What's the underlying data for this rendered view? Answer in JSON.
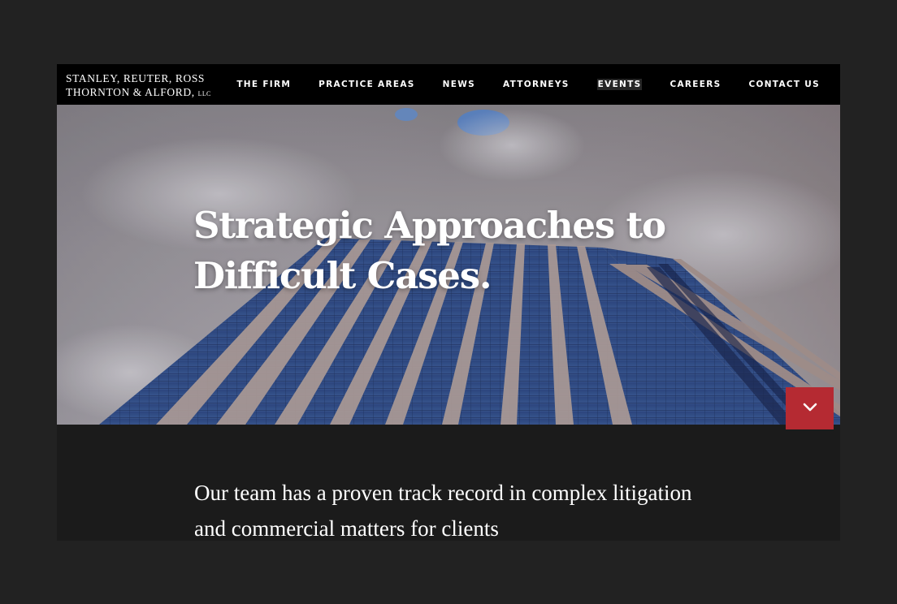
{
  "logo": {
    "line1": "STANLEY, REUTER, ROSS",
    "line2": "THORNTON & ALFORD,",
    "suffix": "LLC"
  },
  "nav": {
    "items": [
      "THE FIRM",
      "PRACTICE AREAS",
      "NEWS",
      "ATTORNEYS",
      "EVENTS",
      "CAREERS",
      "CONTACT US"
    ],
    "active": "EVENTS"
  },
  "hero": {
    "headline": "Strategic Approaches to Difficult Cases.",
    "scroll_icon": "chevron-down-icon",
    "scroll_button_color": "#b52a32"
  },
  "intro": {
    "text": "Our team has a proven track record in complex litigation and commercial matters for clients"
  }
}
